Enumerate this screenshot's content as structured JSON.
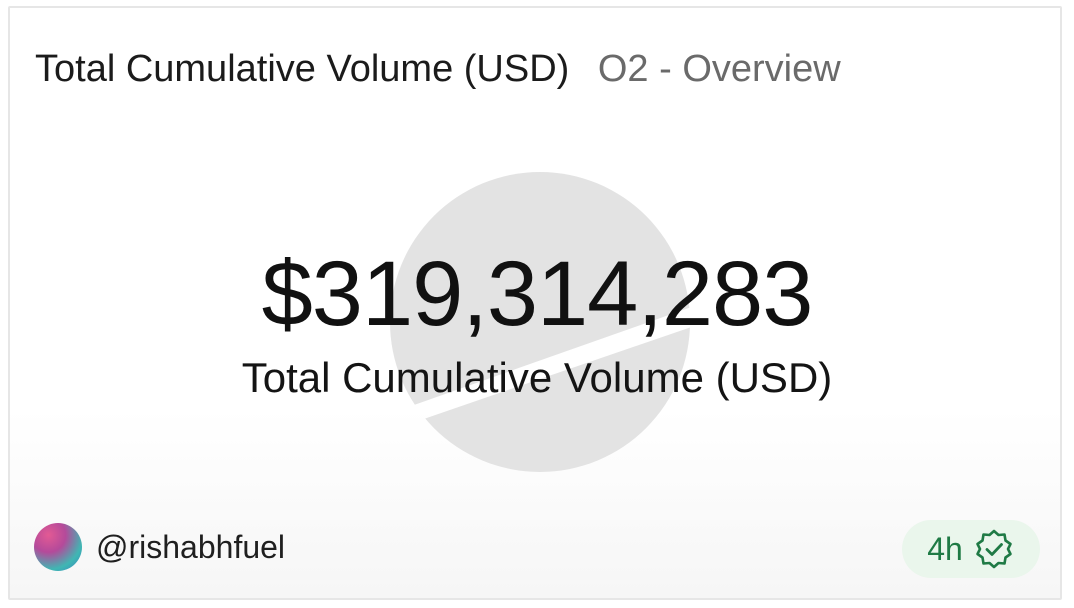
{
  "header": {
    "title": "Total Cumulative Volume (USD)",
    "subtitle": "O2 - Overview"
  },
  "metric": {
    "value": "$319,314,283",
    "label": "Total Cumulative Volume (USD)"
  },
  "author": {
    "handle": "@rishabhfuel",
    "avatar_icon": "avatar"
  },
  "freshness": {
    "age": "4h",
    "icon": "verified-check-badge-icon",
    "color": "#1f7a45",
    "background": "#eaf6ec"
  },
  "watermark": {
    "icon": "dune-logo-watermark-icon",
    "color": "#e3e3e3"
  }
}
